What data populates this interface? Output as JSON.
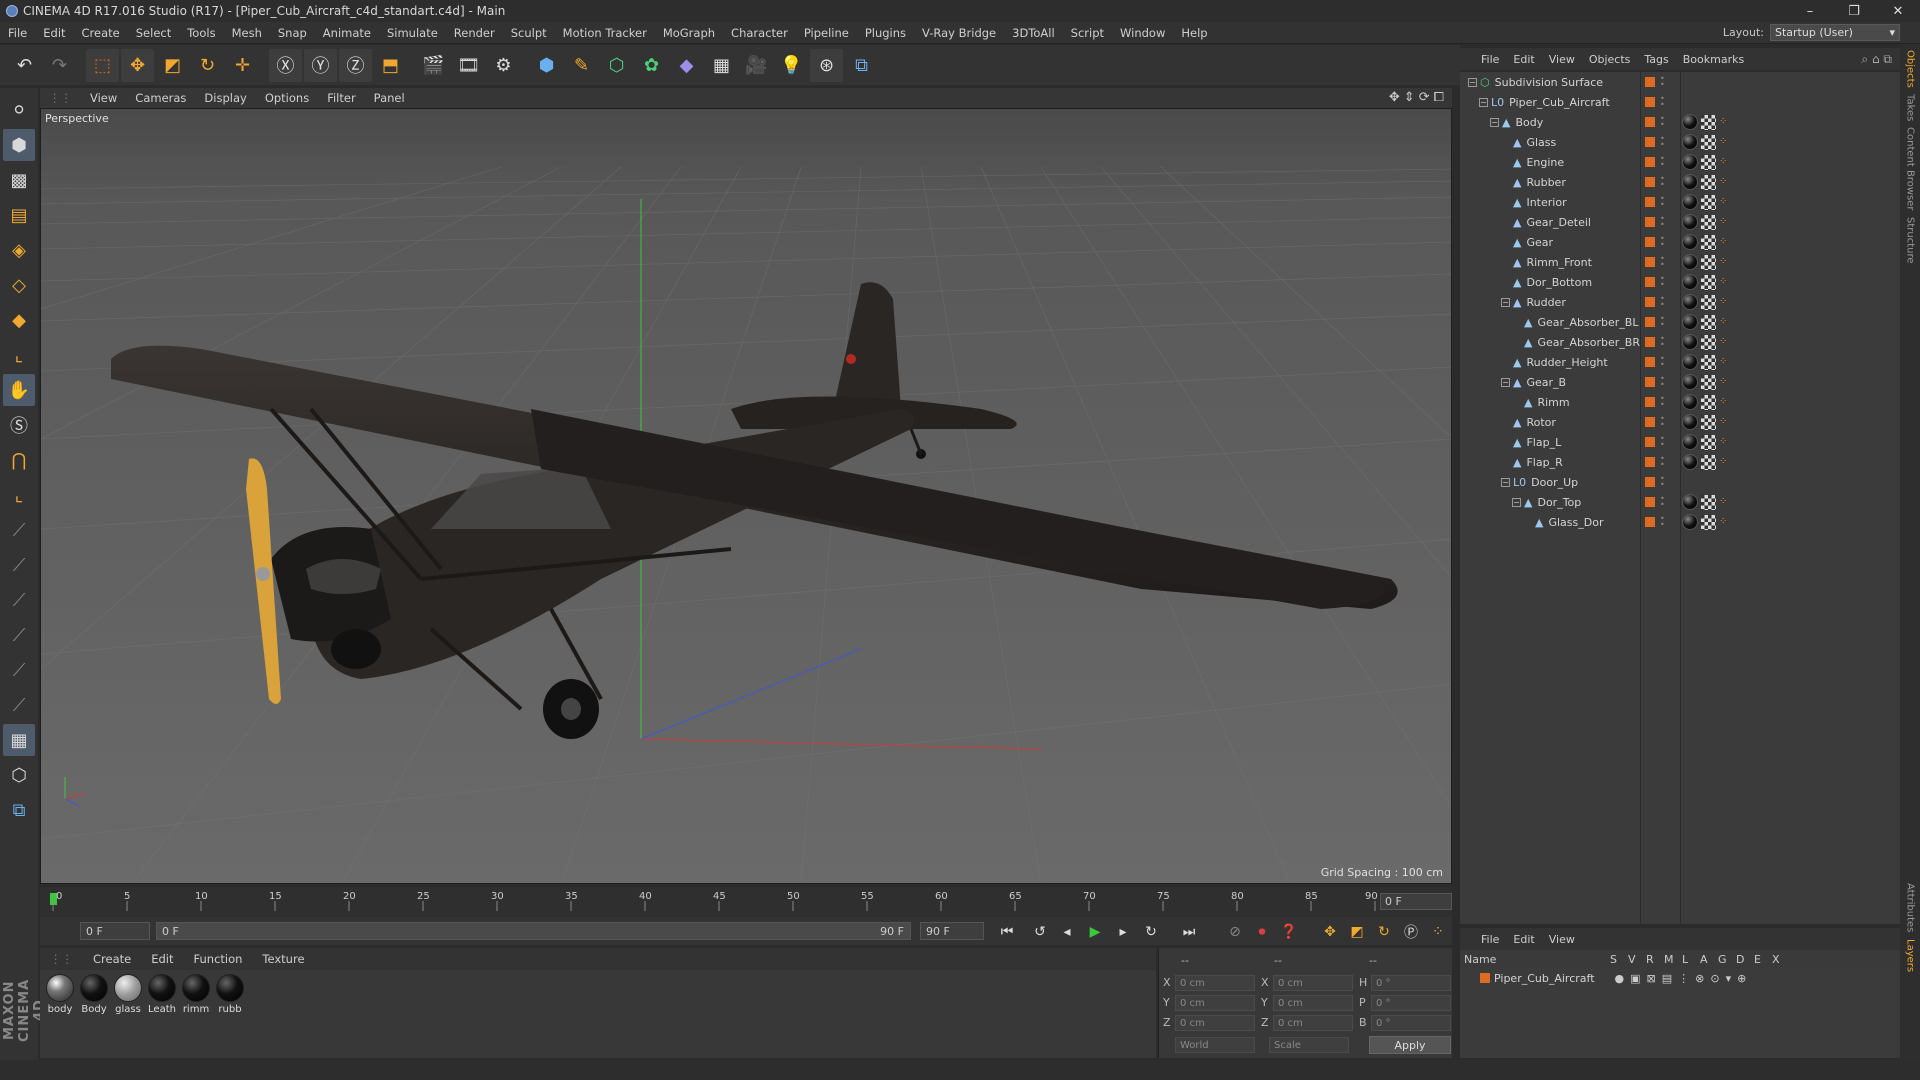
{
  "window": {
    "title": "CINEMA 4D R17.016 Studio (R17) - [Piper_Cub_Aircraft_c4d_standart.c4d] - Main",
    "controls": [
      "–",
      "❐",
      "✕"
    ]
  },
  "menubar": {
    "items": [
      "File",
      "Edit",
      "Create",
      "Select",
      "Tools",
      "Mesh",
      "Snap",
      "Animate",
      "Simulate",
      "Render",
      "Sculpt",
      "Motion Tracker",
      "MoGraph",
      "Character",
      "Pipeline",
      "Plugins",
      "V-Ray Bridge",
      "3DToAll",
      "Script",
      "Window",
      "Help"
    ],
    "layout_label": "Layout:",
    "layout_value": "Startup (User)"
  },
  "viewport": {
    "menu": [
      "View",
      "Cameras",
      "Display",
      "Options",
      "Filter",
      "Panel"
    ],
    "label": "Perspective",
    "grid_spacing": "Grid Spacing : 100 cm"
  },
  "timeline": {
    "ticks": [
      "0",
      "5",
      "10",
      "15",
      "20",
      "25",
      "30",
      "35",
      "40",
      "45",
      "50",
      "55",
      "60",
      "65",
      "70",
      "75",
      "80",
      "85",
      "90"
    ],
    "current_frame": "0 F",
    "start_field": "0 F",
    "range_start": "0 F",
    "range_end": "90 F",
    "end_field": "90 F"
  },
  "material_manager": {
    "menu": [
      "Create",
      "Edit",
      "Function",
      "Texture"
    ],
    "materials": [
      {
        "name": "body",
        "kind": "tex"
      },
      {
        "name": "Body",
        "kind": "dark"
      },
      {
        "name": "glass",
        "kind": "glass"
      },
      {
        "name": "Leath",
        "kind": "dark"
      },
      {
        "name": "rimm",
        "kind": "dark"
      },
      {
        "name": "rubb",
        "kind": "dark"
      }
    ]
  },
  "coordinates": {
    "header": [
      "--",
      "--",
      "--"
    ],
    "rows": [
      {
        "a": "X",
        "av": "0 cm",
        "b": "X",
        "bv": "0 cm",
        "c": "H",
        "cv": "0 °"
      },
      {
        "a": "Y",
        "av": "0 cm",
        "b": "Y",
        "bv": "0 cm",
        "c": "P",
        "cv": "0 °"
      },
      {
        "a": "Z",
        "av": "0 cm",
        "b": "Z",
        "bv": "0 cm",
        "c": "B",
        "cv": "0 °"
      }
    ],
    "world": "World",
    "scale": "Scale",
    "apply": "Apply"
  },
  "object_manager": {
    "menu": [
      "File",
      "Edit",
      "View",
      "Objects",
      "Tags",
      "Bookmarks"
    ],
    "objects": [
      {
        "name": "Subdivision Surface",
        "depth": 0,
        "expander": "−",
        "icon": "subdivision-icon",
        "tags": 0
      },
      {
        "name": "Piper_Cub_Aircraft",
        "depth": 1,
        "expander": "−",
        "icon": "null-icon",
        "tags": 0
      },
      {
        "name": "Body",
        "depth": 2,
        "expander": "−",
        "icon": "polygon-icon",
        "tags": 3
      },
      {
        "name": "Glass",
        "depth": 3,
        "expander": "",
        "icon": "polygon-icon",
        "tags": 3
      },
      {
        "name": "Engine",
        "depth": 3,
        "expander": "",
        "icon": "polygon-icon",
        "tags": 3
      },
      {
        "name": "Rubber",
        "depth": 3,
        "expander": "",
        "icon": "polygon-icon",
        "tags": 3
      },
      {
        "name": "Interior",
        "depth": 3,
        "expander": "",
        "icon": "polygon-icon",
        "tags": 3
      },
      {
        "name": "Gear_Deteil",
        "depth": 3,
        "expander": "",
        "icon": "polygon-icon",
        "tags": 3
      },
      {
        "name": "Gear",
        "depth": 3,
        "expander": "",
        "icon": "polygon-icon",
        "tags": 3
      },
      {
        "name": "Rimm_Front",
        "depth": 3,
        "expander": "",
        "icon": "polygon-icon",
        "tags": 3
      },
      {
        "name": "Dor_Bottom",
        "depth": 3,
        "expander": "",
        "icon": "polygon-icon",
        "tags": 3
      },
      {
        "name": "Rudder",
        "depth": 3,
        "expander": "−",
        "icon": "polygon-icon",
        "tags": 3
      },
      {
        "name": "Gear_Absorber_BL",
        "depth": 4,
        "expander": "",
        "icon": "polygon-icon",
        "tags": 3
      },
      {
        "name": "Gear_Absorber_BR",
        "depth": 4,
        "expander": "",
        "icon": "polygon-icon",
        "tags": 3
      },
      {
        "name": "Rudder_Height",
        "depth": 3,
        "expander": "",
        "icon": "polygon-icon",
        "tags": 3
      },
      {
        "name": "Gear_B",
        "depth": 3,
        "expander": "−",
        "icon": "polygon-icon",
        "tags": 3
      },
      {
        "name": "Rimm",
        "depth": 4,
        "expander": "",
        "icon": "polygon-icon",
        "tags": 3
      },
      {
        "name": "Rotor",
        "depth": 3,
        "expander": "",
        "icon": "polygon-icon",
        "tags": 3
      },
      {
        "name": "Flap_L",
        "depth": 3,
        "expander": "",
        "icon": "polygon-icon",
        "tags": 3
      },
      {
        "name": "Flap_R",
        "depth": 3,
        "expander": "",
        "icon": "polygon-icon",
        "tags": 3
      },
      {
        "name": "Door_Up",
        "depth": 3,
        "expander": "−",
        "icon": "null-icon",
        "tags": 0
      },
      {
        "name": "Dor_Top",
        "depth": 4,
        "expander": "−",
        "icon": "polygon-icon",
        "tags": 3
      },
      {
        "name": "Glass_Dor",
        "depth": 5,
        "expander": "",
        "icon": "polygon-icon",
        "tags": 3
      }
    ]
  },
  "layer_manager": {
    "menu": [
      "File",
      "Edit",
      "View"
    ],
    "columns": [
      "Name",
      "S",
      "V",
      "R",
      "M",
      "L",
      "A",
      "G",
      "D",
      "E",
      "X"
    ],
    "layers": [
      {
        "name": "Piper_Cub_Aircraft"
      }
    ]
  },
  "side_tabs": [
    "Objects",
    "Takes",
    "Content Browser",
    "Structure",
    "Attributes",
    "Layers"
  ],
  "brand": "MAXON CINEMA 4D",
  "colors": {
    "accent_orange": "#e06a1f",
    "viewport_bg": "#5d5d5d",
    "axis_x": "#c83c3c",
    "axis_y": "#3cc83c",
    "axis_z": "#3c5ad2",
    "propeller": "#d9a23a"
  }
}
